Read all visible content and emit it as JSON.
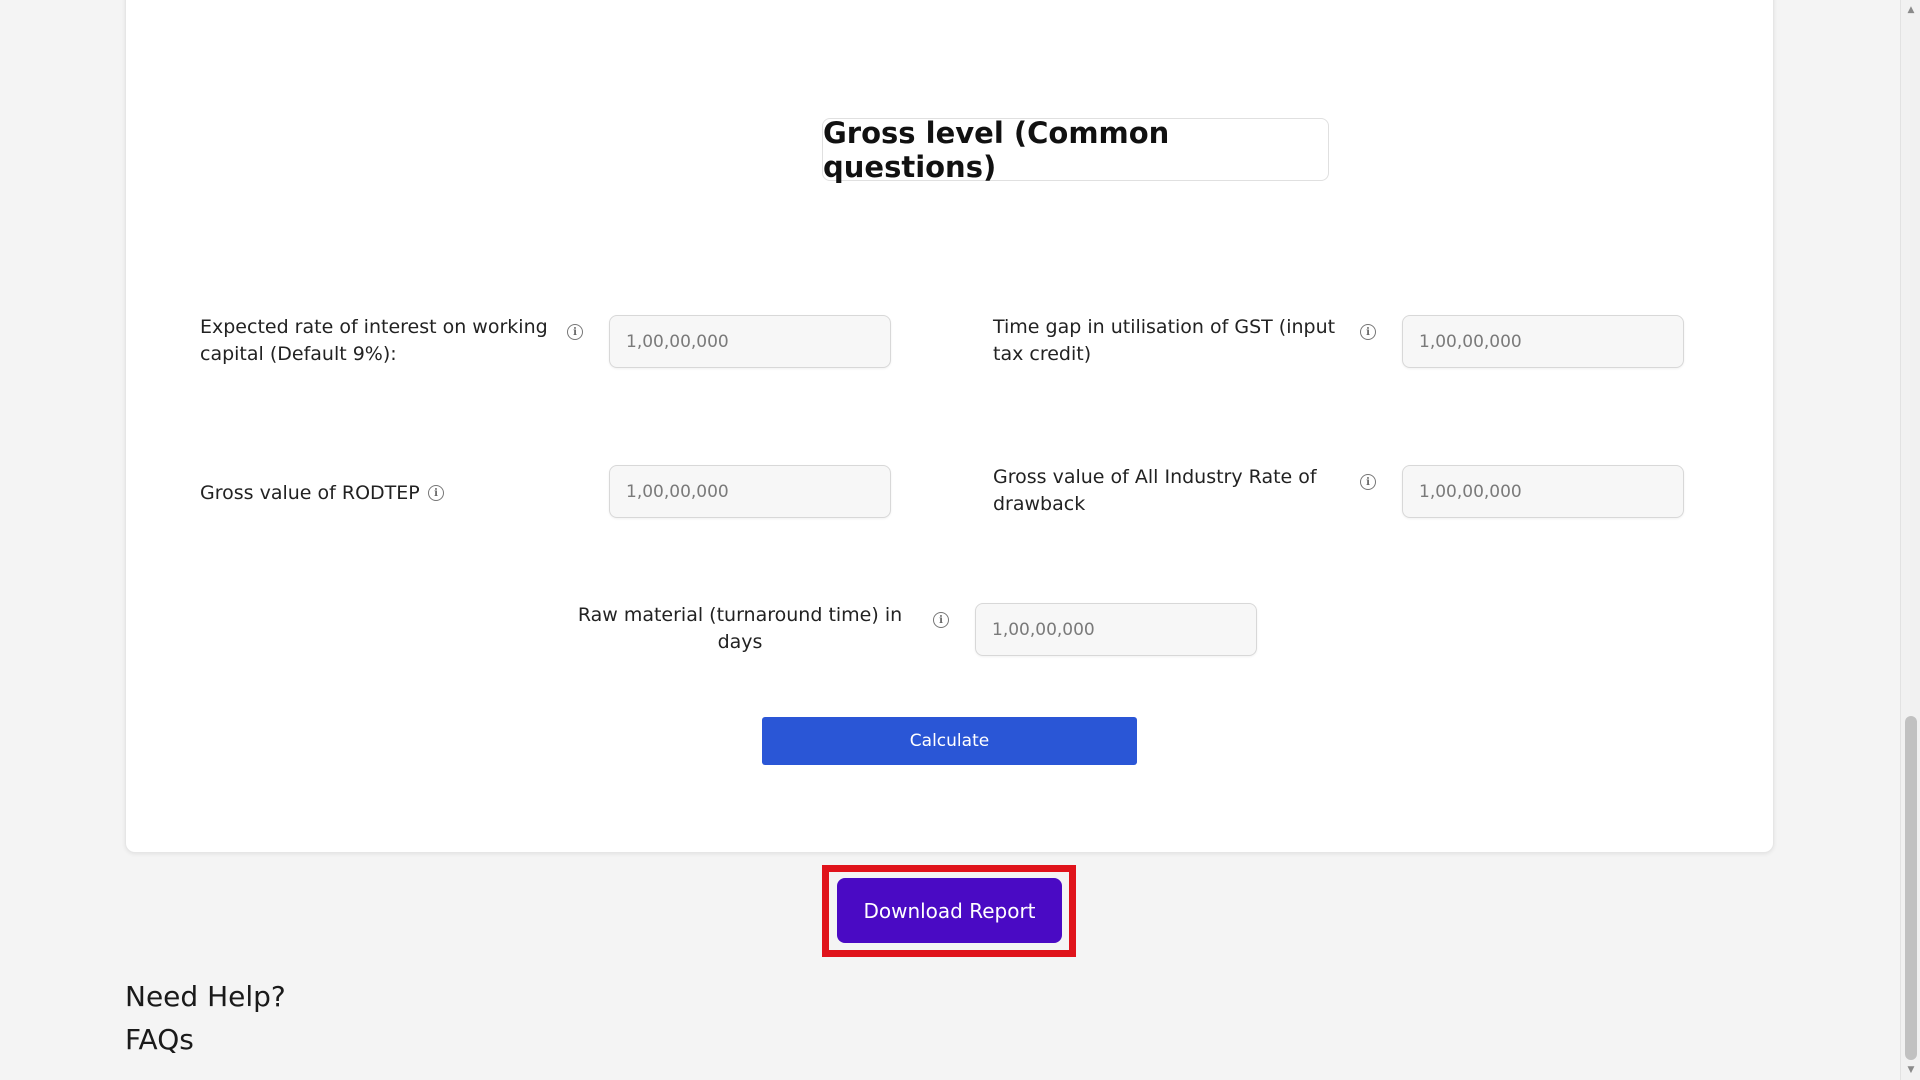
{
  "section": {
    "title": "Gross level (Common questions)"
  },
  "fields": [
    {
      "label": "Expected rate of interest on working capital (Default 9%):",
      "placeholder": "1,00,00,000"
    },
    {
      "label": "Time gap in utilisation of GST (input tax credit)",
      "placeholder": "1,00,00,000"
    },
    {
      "label": "Gross value of RODTEP",
      "placeholder": "1,00,00,000"
    },
    {
      "label": "Gross value of All Industry Rate of drawback",
      "placeholder": "1,00,00,000"
    },
    {
      "label": "Raw material (turnaround time) in days",
      "placeholder": "1,00,00,000"
    }
  ],
  "info_icon": {
    "glyph": "i",
    "name": "info-icon"
  },
  "actions": {
    "calculate_label": "Calculate",
    "download_label": "Download Report"
  },
  "footer": {
    "help_title": "Need Help?",
    "faq_label": "FAQs"
  },
  "scrollbar": {
    "up_glyph": "▲",
    "down_glyph": "▼"
  },
  "colors": {
    "calculate_button": "#2a56d6",
    "download_button": "#4a0ac4",
    "highlight_border": "#e0131b"
  }
}
